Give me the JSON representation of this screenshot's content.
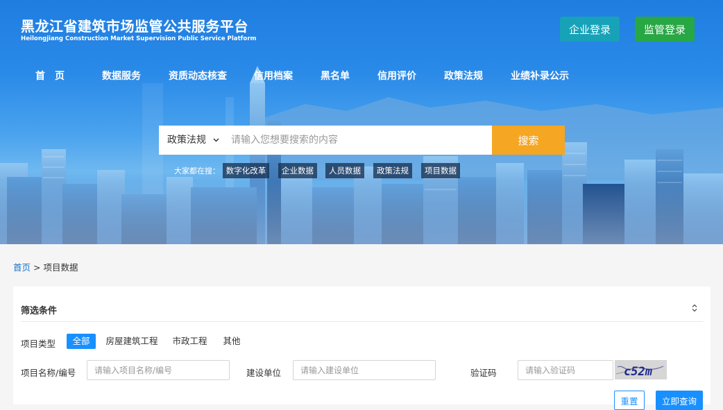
{
  "header": {
    "title_cn": "黑龙江省建筑市场监管公共服务平台",
    "title_en": "Heilongjiang Construction Market Supervision Public Service Platform",
    "enterprise_login": "企业登录",
    "supervision_login": "监管登录"
  },
  "nav": {
    "items": [
      {
        "label": "首　页"
      },
      {
        "label": "数据服务"
      },
      {
        "label": "资质动态核查"
      },
      {
        "label": "信用档案"
      },
      {
        "label": "黑名单"
      },
      {
        "label": "信用评价"
      },
      {
        "label": "政策法规"
      },
      {
        "label": "业绩补录公示"
      }
    ]
  },
  "search": {
    "category": "政策法规",
    "placeholder": "请输入您想要搜索的内容",
    "button": "搜索",
    "hot_label": "大家都在搜：",
    "hot_tags": [
      "数字化改革",
      "企业数据",
      "人员数据",
      "政策法规",
      "项目数据"
    ]
  },
  "breadcrumb": {
    "home": "首页",
    "separator": " > ",
    "current": "项目数据"
  },
  "filter": {
    "title": "筛选条件",
    "type_label": "项目类型",
    "types": [
      "全部",
      "房屋建筑工程",
      "市政工程",
      "其他"
    ],
    "name_label": "项目名称/编号",
    "name_placeholder": "请输入项目名称/编号",
    "unit_label": "建设单位",
    "unit_placeholder": "请输入建设单位",
    "captcha_label": "验证码",
    "captcha_placeholder": "请输入验证码",
    "captcha_text": "c52m",
    "reset": "重置",
    "query": "立即查询"
  },
  "colors": {
    "primary": "#1890ff",
    "search_button": "#f5a623",
    "enterprise_login": "#17a2b8",
    "supervision_login": "#28a745",
    "link": "#1a73c8"
  }
}
